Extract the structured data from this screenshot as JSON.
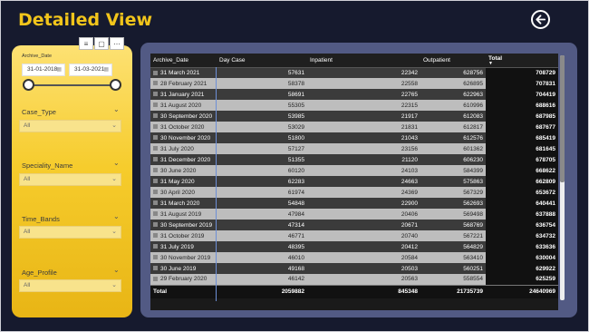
{
  "header": {
    "title": "Detailed View"
  },
  "filters": {
    "archive_date": {
      "label": "Archive_Date",
      "from": "31-01-2018",
      "to": "31-03-2021"
    },
    "case_type": {
      "label": "Case_Type",
      "value": "All"
    },
    "speciality": {
      "label": "Speciality_Name",
      "value": "All"
    },
    "time_bands": {
      "label": "Time_Bands",
      "value": "All"
    },
    "age_profile": {
      "label": "Age_Profile",
      "value": "All"
    },
    "tools": [
      "filter-icon",
      "focus-mode-icon",
      "more-options-icon"
    ]
  },
  "table": {
    "columns": [
      "Archive_Date",
      "Day Case",
      "Inpatient",
      "Outpatient",
      "Total"
    ],
    "rows": [
      [
        "31 March 2021",
        "57631",
        "22342",
        "628756",
        "708729"
      ],
      [
        "28 February 2021",
        "58378",
        "22558",
        "626895",
        "707831"
      ],
      [
        "31 January 2021",
        "58691",
        "22765",
        "622963",
        "704419"
      ],
      [
        "31 August 2020",
        "55305",
        "22315",
        "610996",
        "688616"
      ],
      [
        "30 September 2020",
        "53985",
        "21917",
        "612083",
        "687985"
      ],
      [
        "31 October 2020",
        "53029",
        "21831",
        "612817",
        "687677"
      ],
      [
        "30 November 2020",
        "51800",
        "21043",
        "612576",
        "685419"
      ],
      [
        "31 July 2020",
        "57127",
        "23156",
        "601362",
        "681645"
      ],
      [
        "31 December 2020",
        "51355",
        "21120",
        "606230",
        "678705"
      ],
      [
        "30 June 2020",
        "60120",
        "24103",
        "584399",
        "668622"
      ],
      [
        "31 May 2020",
        "62283",
        "24663",
        "575863",
        "662809"
      ],
      [
        "30 April 2020",
        "61974",
        "24369",
        "567329",
        "653672"
      ],
      [
        "31 March 2020",
        "54848",
        "22900",
        "562693",
        "640441"
      ],
      [
        "31 August 2019",
        "47984",
        "20406",
        "569498",
        "637888"
      ],
      [
        "30 September 2019",
        "47314",
        "20671",
        "568769",
        "636754"
      ],
      [
        "31 October 2019",
        "46771",
        "20740",
        "567221",
        "634732"
      ],
      [
        "31 July 2019",
        "48395",
        "20412",
        "564829",
        "633636"
      ],
      [
        "30 November 2019",
        "46010",
        "20584",
        "563410",
        "630004"
      ],
      [
        "30 June 2019",
        "49168",
        "20503",
        "560251",
        "629922"
      ],
      [
        "29 February 2020",
        "46142",
        "20563",
        "558554",
        "625259"
      ]
    ],
    "total": [
      "Total",
      "2059882",
      "845348",
      "21735739",
      "24640969"
    ]
  },
  "colors": {
    "accent": "#f2c51b",
    "background": "#161a2e",
    "panel": "#525a84"
  }
}
